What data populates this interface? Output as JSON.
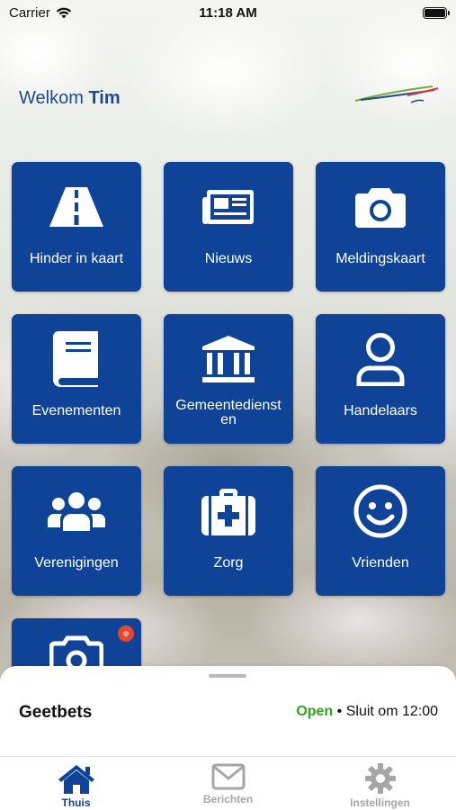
{
  "status_bar": {
    "carrier": "Carrier",
    "time": "11:18 AM"
  },
  "header": {
    "welcome_prefix": "Welkom",
    "user_name": "Tim"
  },
  "tiles": [
    {
      "label": "Hinder in kaart",
      "icon": "road-icon"
    },
    {
      "label": "Nieuws",
      "icon": "newspaper-icon"
    },
    {
      "label": "Meldingskaart",
      "icon": "camera-icon"
    },
    {
      "label": "Evenementen",
      "icon": "book-icon"
    },
    {
      "label": "Gemeentedienst\nen",
      "icon": "building-icon"
    },
    {
      "label": "Handelaars",
      "icon": "person-icon"
    },
    {
      "label": "Verenigingen",
      "icon": "group-icon"
    },
    {
      "label": "Zorg",
      "icon": "medical-kit-icon"
    },
    {
      "label": "Vrienden",
      "icon": "smiley-icon"
    }
  ],
  "partial_tile": {
    "icon": "camera-icon",
    "badge_icon": "instagram-badge-icon"
  },
  "store": {
    "name": "Geetbets",
    "status": "Open",
    "separator": "•",
    "closing": "Sluit om 12:00"
  },
  "tabbar": [
    {
      "label": "Thuis",
      "icon": "home-icon",
      "active": true
    },
    {
      "label": "Berichten",
      "icon": "envelope-icon",
      "active": false
    },
    {
      "label": "Instellingen",
      "icon": "gear-icon",
      "active": false
    }
  ],
  "colors": {
    "tile": "#0f4398",
    "accent": "#1c4a8f",
    "open": "#2ea51c",
    "tab_inactive": "#a6a6a6"
  }
}
